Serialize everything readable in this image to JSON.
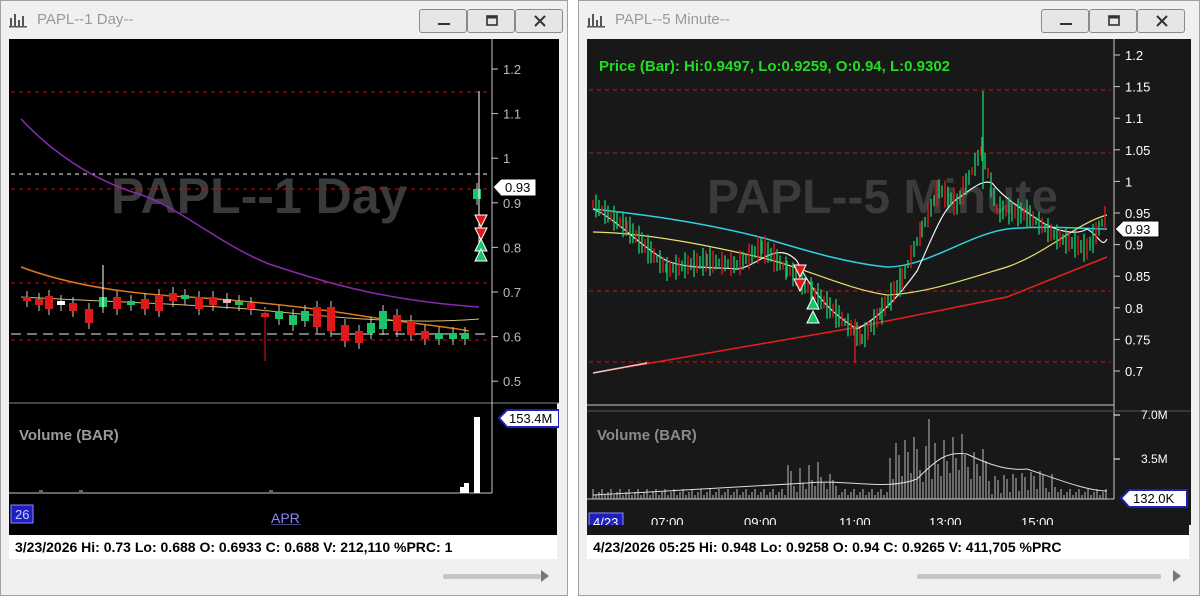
{
  "left_window": {
    "title": "PAPL--1 Day--",
    "watermark": "PAPL--1 Day",
    "price_axis": [
      "1.2",
      "1.1",
      "1",
      "0.9",
      "0.8",
      "0.7",
      "0.6",
      "0.5"
    ],
    "price_badge": "0.93",
    "volume_label": "Volume (BAR)",
    "volume_badge": "153.4M",
    "date_labels": [
      "26",
      "APR"
    ],
    "status": "3/23/2026  Hi: 0.73  Lo: 0.688  O: 0.6933  C: 0.688  V: 212,110 %PRC: 1"
  },
  "right_window": {
    "title": "PAPL--5 Minute--",
    "watermark": "PAPL--5 Minute",
    "price_header": "Price (Bar): Hi:0.9497, Lo:0.9259, O:0.94, L:0.9302",
    "price_axis": [
      "1.2",
      "1.15",
      "1.1",
      "1.05",
      "1",
      "0.95",
      "0.9",
      "0.85",
      "0.8",
      "0.75",
      "0.7"
    ],
    "price_badge": "0.93",
    "volume_label": "Volume (BAR)",
    "volume_axis": [
      "7.0M",
      "3.5M"
    ],
    "volume_badge": "132.0K",
    "time_labels": [
      "4/23",
      "07:00",
      "09:00",
      "11:00",
      "13:00",
      "15:00"
    ],
    "status": "4/23/2026 05:25  Hi: 0.948  Lo: 0.9258  O: 0.94  C: 0.9265  V: 411,705 %PRC"
  },
  "colors": {
    "bull": "#19c46b",
    "bear": "#e01818",
    "accent_badge": "#1f1fbf",
    "header_green": "#22dd22"
  }
}
